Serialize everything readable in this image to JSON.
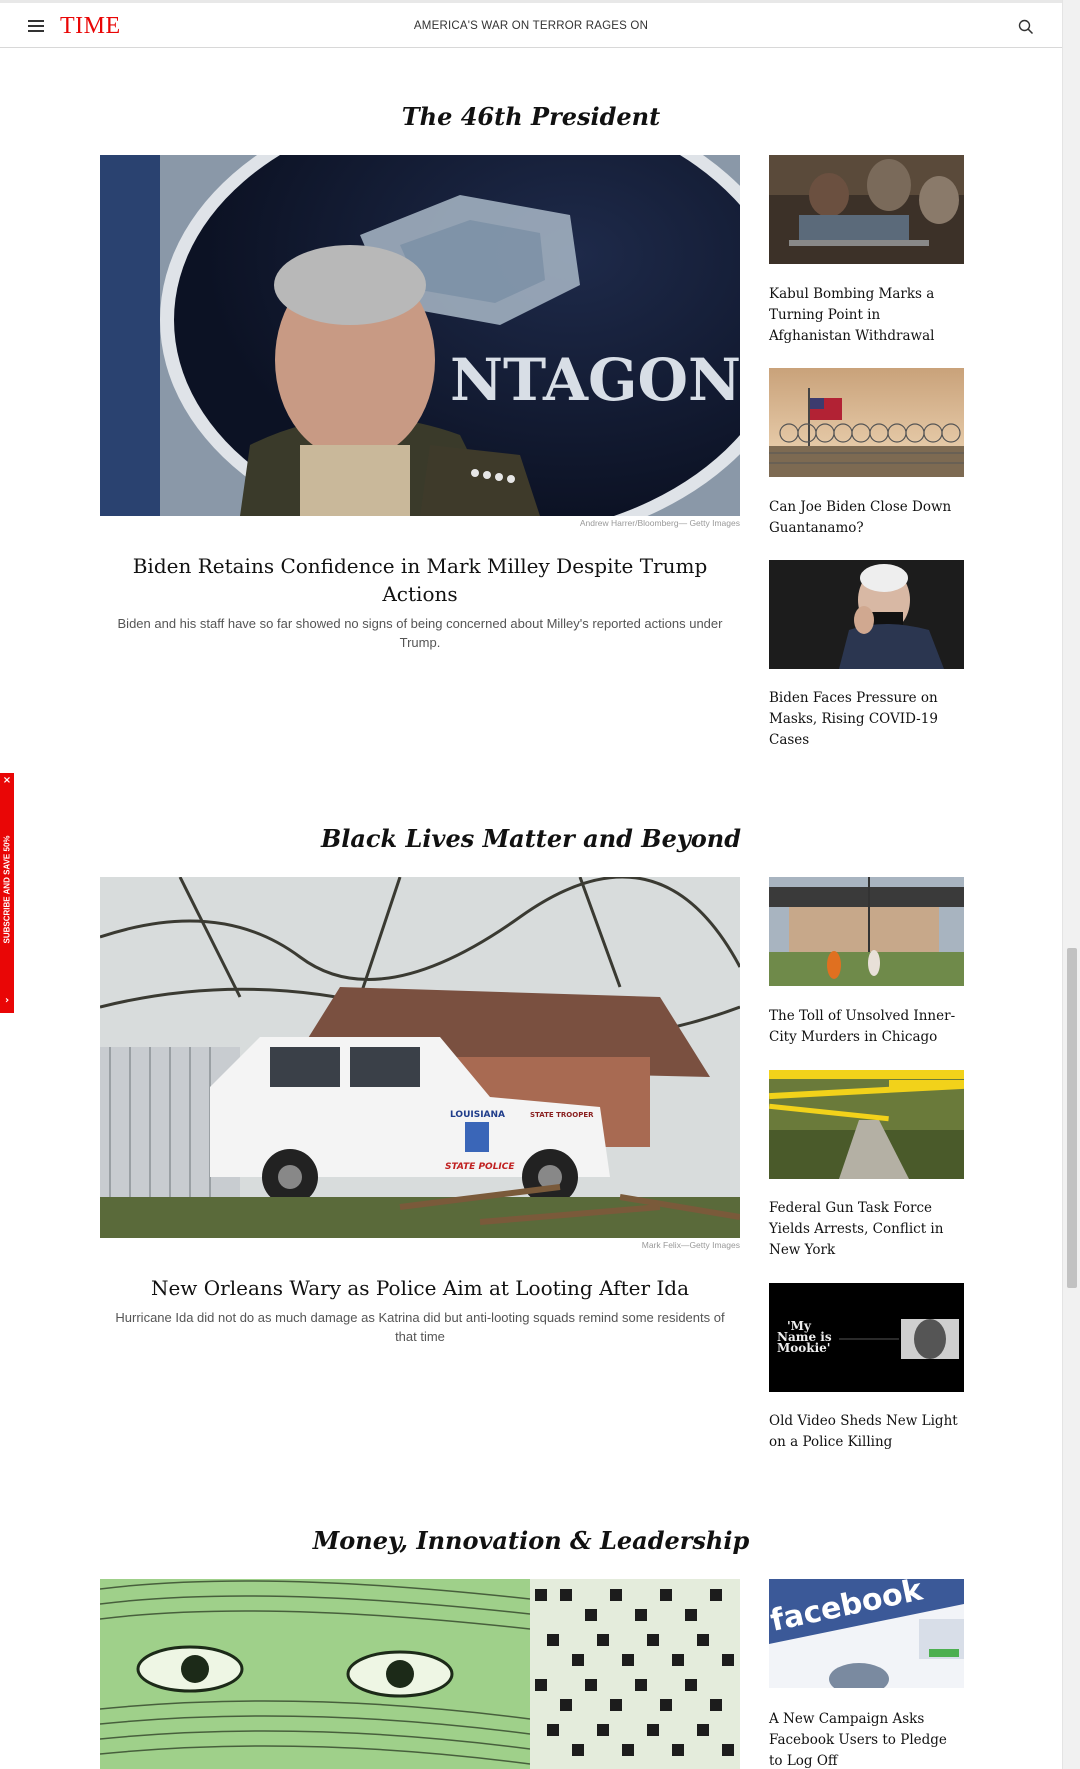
{
  "header": {
    "logo": "TIME",
    "ticker": "AMERICA'S WAR ON TERROR RAGES ON"
  },
  "promo": {
    "close": "×",
    "text": "SUBSCRIBE AND SAVE 50%",
    "arrow": "›"
  },
  "sections": [
    {
      "title": "The 46th President",
      "hero": {
        "title": "Biden Retains Confidence in Mark Milley Despite Trump Actions",
        "description": "Biden and his staff have so far showed no signs of being concerned about Milley's reported actions under Trump.",
        "credit": "Andrew Harrer/Bloomberg— Getty Images",
        "image_text": "NTAGON"
      },
      "side": [
        {
          "title": "Kabul Bombing Marks a Turning Point in Afghanistan Withdrawal"
        },
        {
          "title": "Can Joe Biden Close Down Guantanamo?"
        },
        {
          "title": "Biden Faces Pressure on Masks, Rising COVID-19 Cases"
        }
      ]
    },
    {
      "title": "Black Lives Matter and Beyond",
      "hero": {
        "title": "New Orleans Wary as Police Aim at Looting After Ida",
        "description": "Hurricane Ida did not do as much damage as Katrina did but anti-looting squads remind some residents of that time",
        "credit": "Mark Felix—Getty Images",
        "image_text_1": "LOUISIANA",
        "image_text_2": "STATE TROOPER",
        "image_text_3": "STATE POLICE"
      },
      "side": [
        {
          "title": "The Toll of Unsolved Inner-City Murders in Chicago"
        },
        {
          "title": "Federal Gun Task Force Yields Arrests, Conflict in New York"
        },
        {
          "title": "Old Video Sheds New Light on a Police Killing",
          "image_text_1": "'My",
          "image_text_2": "Name is",
          "image_text_3": "Mookie'"
        }
      ]
    },
    {
      "title": "Money, Innovation & Leadership",
      "side": [
        {
          "title": "A New Campaign Asks Facebook Users to Pledge to Log Off",
          "image_text": "facebook"
        }
      ]
    }
  ],
  "colors": {
    "brand_red": "#e90606"
  }
}
